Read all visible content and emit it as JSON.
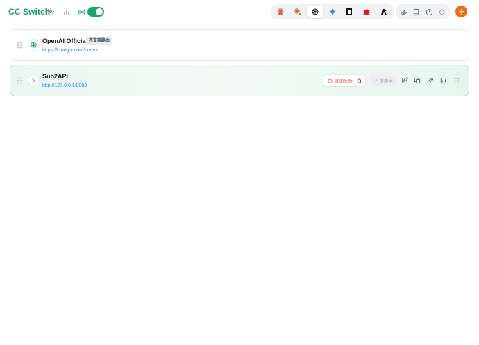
{
  "header": {
    "title": "CC Switch",
    "icons": [
      "gear-icon",
      "bar-chart-icon",
      "broadcast-icon"
    ],
    "proxy_toggle_on": true,
    "brand_color": "#1fa36b",
    "app_tabs": [
      {
        "name": "claude",
        "icon": "claude-icon",
        "active": false
      },
      {
        "name": "claude-code",
        "icon": "claude-code-icon",
        "active": false
      },
      {
        "name": "codex",
        "icon": "openai-icon",
        "active": true
      },
      {
        "name": "gemini",
        "icon": "gemini-icon",
        "active": false
      },
      {
        "name": "opencode",
        "icon": "opencode-icon",
        "active": false
      },
      {
        "name": "bug",
        "icon": "red-bug-icon",
        "active": false
      },
      {
        "name": "agent",
        "icon": "agent-icon",
        "active": false
      }
    ],
    "tools": [
      "wrench-icon",
      "book-icon",
      "history-icon",
      "cloud-sync-icon"
    ],
    "add_color": "#f06d1a"
  },
  "providers": [
    {
      "name": "OpenAI Official",
      "badge": "不支持路由",
      "url": "https://chatgpt.com/codex",
      "icon": "openai-icon",
      "active": false
    },
    {
      "name": "Sub2API",
      "icon_letter": "S",
      "url": "http://127.0.0.1:8080",
      "status": "查询失败",
      "use_label": "使用中",
      "active": true
    }
  ]
}
